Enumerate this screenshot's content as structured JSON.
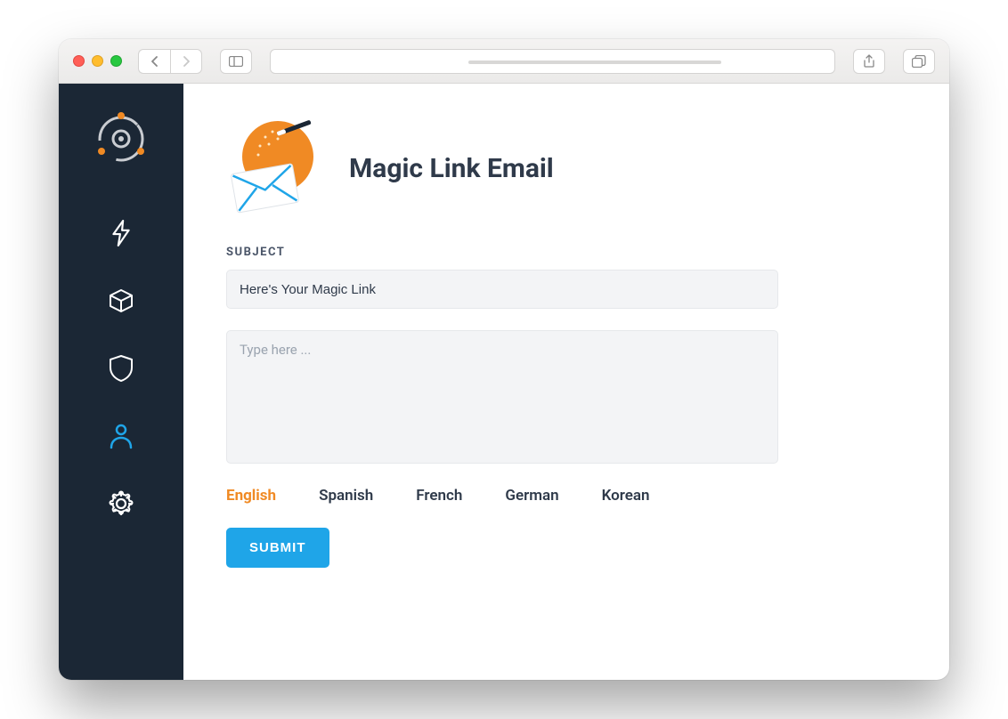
{
  "page": {
    "title": "Magic Link Email",
    "subject_label": "SUBJECT",
    "subject_value": "Here's Your Magic Link",
    "body_placeholder": "Type here ...",
    "submit_label": "SUBMIT"
  },
  "languages": [
    {
      "label": "English",
      "active": true
    },
    {
      "label": "Spanish",
      "active": false
    },
    {
      "label": "French",
      "active": false
    },
    {
      "label": "German",
      "active": false
    },
    {
      "label": "Korean",
      "active": false
    }
  ],
  "sidebar": {
    "items": [
      {
        "name": "lightning",
        "active": false
      },
      {
        "name": "cube",
        "active": false
      },
      {
        "name": "shield",
        "active": false
      },
      {
        "name": "user",
        "active": true
      },
      {
        "name": "settings",
        "active": false
      }
    ]
  },
  "colors": {
    "accent": "#f08a24",
    "primary": "#1fa5e8",
    "sidebar_bg": "#1b2735",
    "text": "#2f3a4a"
  }
}
